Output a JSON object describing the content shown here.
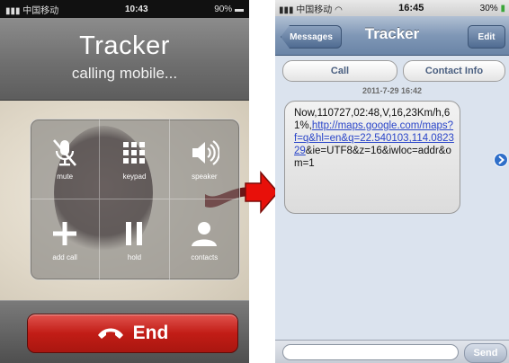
{
  "call_screen": {
    "status_bar": {
      "carrier": "中国移动",
      "time": "10:43",
      "battery": "90%"
    },
    "contact_name": "Tracker",
    "call_status": "calling mobile...",
    "buttons": [
      {
        "label": "mute",
        "icon": "mute-icon"
      },
      {
        "label": "keypad",
        "icon": "keypad-icon"
      },
      {
        "label": "speaker",
        "icon": "speaker-icon"
      },
      {
        "label": "add call",
        "icon": "add-call-icon"
      },
      {
        "label": "hold",
        "icon": "hold-icon"
      },
      {
        "label": "contacts",
        "icon": "contacts-icon"
      }
    ],
    "end_label": "End",
    "colors": {
      "end_button": "#c21d16",
      "header": "#6f6f6f"
    }
  },
  "arrow": {
    "color": "#e8100a"
  },
  "sms_screen": {
    "status_bar": {
      "carrier": "中国移动",
      "time": "16:45",
      "battery": "30%"
    },
    "back_label": "Messages",
    "title": "Tracker",
    "edit_label": "Edit",
    "call_label": "Call",
    "contact_info_label": "Contact Info",
    "timestamp": "2011-7-29 16:42",
    "message": {
      "prefix": "Now,110727,02:48,V,16,23Km/h,61%,",
      "link": "http://maps.google.com/maps?f=q&hl=en&q=22.540103,114.082329",
      "suffix": "&ie=UTF8&z=16&iwloc=addr&om=1"
    },
    "send_label": "Send",
    "colors": {
      "nav_bar": "#7f97b6",
      "link": "#2a45c9",
      "detail_icon": "#2f6fc9"
    }
  }
}
